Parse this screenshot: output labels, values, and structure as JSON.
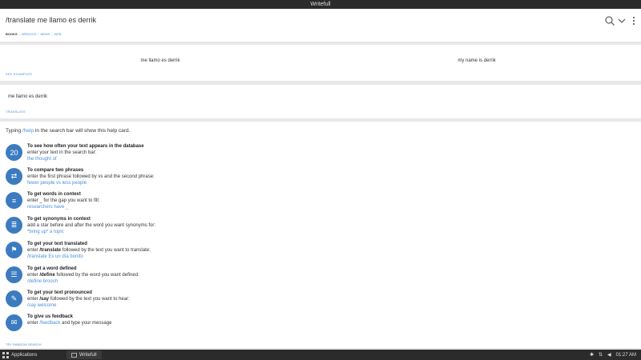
{
  "window": {
    "title": "Writefull"
  },
  "search": {
    "query": "/translate me llamo es derrik"
  },
  "tabs": [
    {
      "label": "BOOKS",
      "active": true
    },
    {
      "label": "WEB/SCH",
      "active": false
    },
    {
      "label": "NEWS",
      "active": false
    },
    {
      "label": "WEB",
      "active": false
    }
  ],
  "compare": {
    "left": "me llamo es derrik",
    "right": "my name is derrik",
    "link": "SEE EXAMPLES"
  },
  "translate_card": {
    "text": "me llamo es derrik",
    "link": "TRANSLATE"
  },
  "help": {
    "intro_before": "Typing ",
    "intro_keyword": "/help",
    "intro_after": " in the search bar will show this help card.",
    "items": [
      {
        "icon": "database-count-icon",
        "glyph": "20",
        "title": "To see how often your text appears in the database",
        "desc_plain": "enter your text in the search bar:",
        "example": "the thought of"
      },
      {
        "icon": "compare-icon",
        "glyph": "⇄",
        "title": "To compare two phrases",
        "desc_plain": "enter the first phrase followed by vs and the second phrase:",
        "example": "fewer people vs less people"
      },
      {
        "icon": "context-icon",
        "glyph": "≡",
        "title": "To get words in context",
        "desc_plain": "enter _ for the gap you want to fill:",
        "example": "researchers have _"
      },
      {
        "icon": "synonyms-icon",
        "glyph": "≣",
        "title": "To get synonyms in context",
        "desc_plain": "add a star before and after the word you want synonyms for:",
        "example": "*bring up* a topic"
      },
      {
        "icon": "translate-flag-icon",
        "glyph": "⚑",
        "title": "To get your text translated",
        "desc_before": "enter ",
        "desc_key": "/translate",
        "desc_after": " followed by the text you want to translate:",
        "example": "/translate Es un día bonito"
      },
      {
        "icon": "define-list-icon",
        "glyph": "☰",
        "title": "To get a word defined",
        "desc_before": "enter ",
        "desc_key": "/define",
        "desc_after": " followed by the word you want defined:",
        "example": "/define brooch"
      },
      {
        "icon": "speaker-icon",
        "glyph": "✎",
        "title": "To get your text pronounced",
        "desc_before": "enter ",
        "desc_key": "/say",
        "desc_after": " followed by the text you want to hear:",
        "example": "/say welcome"
      },
      {
        "icon": "feedback-chat-icon",
        "glyph": "✉",
        "title": "To give us feedback",
        "desc_before": "enter ",
        "desc_key": "/feedback",
        "desc_after": " and type your message",
        "example": "",
        "key_is_link": true
      }
    ]
  },
  "random_link": "TRY RANDOM SEARCH",
  "taskbar": {
    "apps_label": "Applications",
    "window_label": "Writefull",
    "clock": "01:27 AM"
  }
}
